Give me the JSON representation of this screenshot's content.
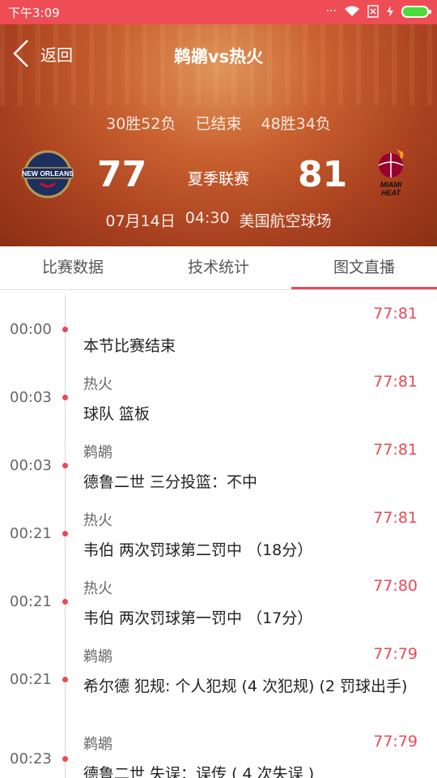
{
  "status_bar": {
    "time": "下午3:09",
    "icons": [
      "dots-icon",
      "wifi-icon",
      "sim-icon",
      "charging-icon",
      "battery-icon"
    ]
  },
  "header": {
    "back_label": "返回",
    "title": "鹈鹕vs热火",
    "home_record": "30胜52负",
    "game_status": "已结束",
    "away_record": "48胜34负",
    "home_score": "77",
    "away_score": "81",
    "league": "夏季联赛",
    "date": "07月14日",
    "time": "04:30",
    "venue": "美国航空球场",
    "home_logo_text": "NEW ORLEANS",
    "away_logo_text_1": "MIAMI",
    "away_logo_text_2": "HEAT"
  },
  "tabs": [
    {
      "label": "比赛数据",
      "active": false
    },
    {
      "label": "技术统计",
      "active": false
    },
    {
      "label": "图文直播",
      "active": true
    }
  ],
  "events": [
    {
      "time": "00:00",
      "team": "",
      "score": "77:81",
      "desc": "本节比赛结束"
    },
    {
      "time": "00:03",
      "team": "热火",
      "score": "77:81",
      "desc": " 球队 篮板"
    },
    {
      "time": "00:03",
      "team": "鹈鹕",
      "score": "77:81",
      "desc": " 德鲁二世 三分投篮：不中"
    },
    {
      "time": "00:21",
      "team": "热火",
      "score": "77:81",
      "desc": " 韦伯 两次罚球第二罚中 （18分）"
    },
    {
      "time": "00:21",
      "team": "热火",
      "score": "77:80",
      "desc": " 韦伯 两次罚球第一罚中 （17分）"
    },
    {
      "time": "00:21",
      "team": "鹈鹕",
      "score": "77:79",
      "desc": " 希尔德 犯规: 个人犯规 (4 次犯规) (2 罚球出手)"
    },
    {
      "time": "00:23",
      "team": "鹈鹕",
      "score": "77:79",
      "desc": " 德鲁二世 失误：误传 ( 4 次失误 )"
    }
  ],
  "colors": {
    "accent": "#e94a55",
    "status_bar": "#ee4d55"
  }
}
